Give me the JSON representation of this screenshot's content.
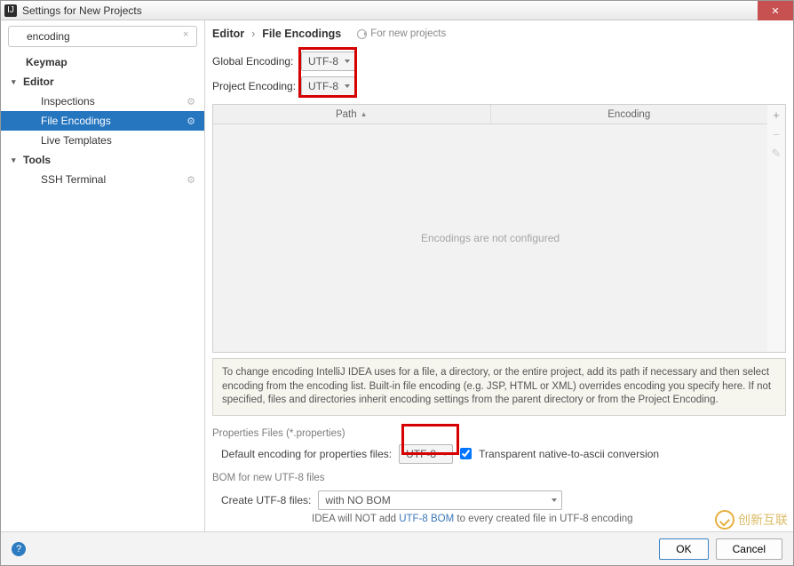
{
  "title": "Settings for New Projects",
  "search": {
    "value": "encoding"
  },
  "tree": {
    "keymap": "Keymap",
    "editor": "Editor",
    "inspections": "Inspections",
    "fileEncodings": "File Encodings",
    "liveTemplates": "Live Templates",
    "tools": "Tools",
    "sshTerminal": "SSH Terminal"
  },
  "crumb": {
    "a": "Editor",
    "b": "File Encodings",
    "badge": "For new projects"
  },
  "enc": {
    "globalLabel": "Global Encoding:",
    "globalValue": "UTF-8",
    "projectLabel": "Project Encoding:",
    "projectValue": "UTF-8"
  },
  "table": {
    "colPath": "Path",
    "colEnc": "Encoding",
    "empty": "Encodings are not configured"
  },
  "hint": "To change encoding IntelliJ IDEA uses for a file, a directory, or the entire project, add its path if necessary and then select encoding from the encoding list. Built-in file encoding (e.g. JSP, HTML or XML) overrides encoding you specify here. If not specified, files and directories inherit encoding settings from the parent directory or from the Project Encoding.",
  "props": {
    "section": "Properties Files (*.properties)",
    "label": "Default encoding for properties files:",
    "value": "UTF-8",
    "checkbox": "Transparent native-to-ascii conversion"
  },
  "bom": {
    "section": "BOM for new UTF-8 files",
    "label": "Create UTF-8 files:",
    "value": "with NO BOM",
    "note1": "IDEA will NOT add ",
    "noteLink": "UTF-8 BOM",
    "note2": " to every created file in UTF-8 encoding"
  },
  "footer": {
    "ok": "OK",
    "cancel": "Cancel"
  },
  "watermark": "创新互联"
}
